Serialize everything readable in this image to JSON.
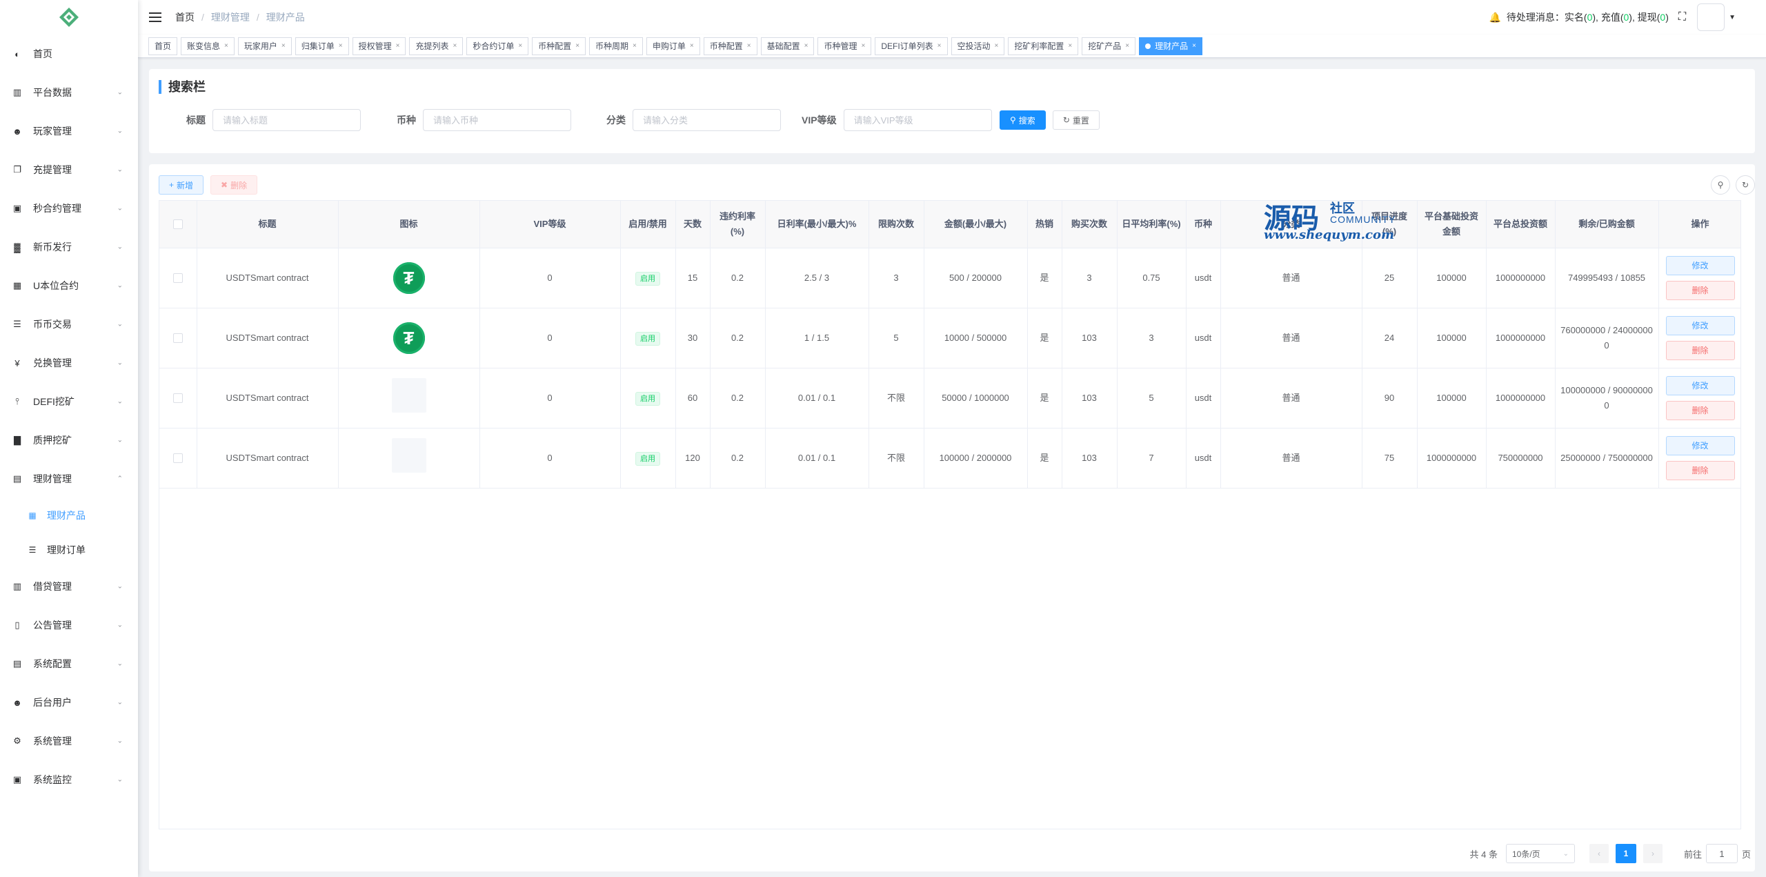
{
  "sidebar": {
    "logo_icon": "diamond-logo-icon",
    "items": [
      {
        "label": "首页",
        "icon": "dashboard-icon",
        "glyph": "◐",
        "has_arrow": false
      },
      {
        "label": "平台数据",
        "icon": "chart-book-icon",
        "glyph": "▥",
        "has_arrow": true
      },
      {
        "label": "玩家管理",
        "icon": "user-icon",
        "glyph": "☻",
        "has_arrow": true
      },
      {
        "label": "充提管理",
        "icon": "copy-icon",
        "glyph": "❐",
        "has_arrow": true
      },
      {
        "label": "秒合约管理",
        "icon": "monitor-icon",
        "glyph": "▣",
        "has_arrow": true
      },
      {
        "label": "新币发行",
        "icon": "chart-icon",
        "glyph": "▓",
        "has_arrow": true
      },
      {
        "label": "U本位合约",
        "icon": "grid-icon",
        "glyph": "▦",
        "has_arrow": true
      },
      {
        "label": "币币交易",
        "icon": "list-icon",
        "glyph": "☰",
        "has_arrow": true
      },
      {
        "label": "兑换管理",
        "icon": "yen-icon",
        "glyph": "¥",
        "has_arrow": true
      },
      {
        "label": "DEFI挖矿",
        "icon": "tree-icon",
        "glyph": "⫯",
        "has_arrow": true
      },
      {
        "label": "质押挖矿",
        "icon": "bar-chart-icon",
        "glyph": "▇",
        "has_arrow": true
      },
      {
        "label": "理财管理",
        "icon": "document-icon",
        "glyph": "▤",
        "has_arrow": true,
        "expanded": true
      }
    ],
    "sub_items": [
      {
        "label": "理财产品",
        "icon": "table-icon",
        "glyph": "▦",
        "active": true
      },
      {
        "label": "理财订单",
        "icon": "list-icon",
        "glyph": "☰",
        "active": false
      }
    ],
    "items_after": [
      {
        "label": "借贷管理",
        "icon": "book-icon",
        "glyph": "▥",
        "has_arrow": true
      },
      {
        "label": "公告管理",
        "icon": "open-book-icon",
        "glyph": "▯",
        "has_arrow": true
      },
      {
        "label": "系统配置",
        "icon": "form-icon",
        "glyph": "▤",
        "has_arrow": true
      },
      {
        "label": "后台用户",
        "icon": "users-icon",
        "glyph": "☻",
        "has_arrow": true
      },
      {
        "label": "系统管理",
        "icon": "gear-icon",
        "glyph": "⚙",
        "has_arrow": true
      },
      {
        "label": "系统监控",
        "icon": "monitor-icon",
        "glyph": "▣",
        "has_arrow": true
      }
    ]
  },
  "header": {
    "breadcrumb": [
      "首页",
      "理财管理",
      "理财产品"
    ],
    "notice_prefix": "待处理消息：",
    "notice_items": [
      {
        "label": "实名",
        "count": "0"
      },
      {
        "label": "充值",
        "count": "0"
      },
      {
        "label": "提现",
        "count": "0"
      }
    ]
  },
  "tags": [
    {
      "label": "首页",
      "closable": false,
      "active": false
    },
    {
      "label": "账变信息",
      "closable": true,
      "active": false
    },
    {
      "label": "玩家用户",
      "closable": true,
      "active": false
    },
    {
      "label": "归集订单",
      "closable": true,
      "active": false
    },
    {
      "label": "授权管理",
      "closable": true,
      "active": false
    },
    {
      "label": "充提列表",
      "closable": true,
      "active": false
    },
    {
      "label": "秒合约订单",
      "closable": true,
      "active": false
    },
    {
      "label": "币种配置",
      "closable": true,
      "active": false
    },
    {
      "label": "币种周期",
      "closable": true,
      "active": false
    },
    {
      "label": "申购订单",
      "closable": true,
      "active": false
    },
    {
      "label": "币种配置",
      "closable": true,
      "active": false
    },
    {
      "label": "基础配置",
      "closable": true,
      "active": false
    },
    {
      "label": "币种管理",
      "closable": true,
      "active": false
    },
    {
      "label": "DEFI订单列表",
      "closable": true,
      "active": false
    },
    {
      "label": "空投活动",
      "closable": true,
      "active": false
    },
    {
      "label": "挖矿利率配置",
      "closable": true,
      "active": false
    },
    {
      "label": "挖矿产品",
      "closable": true,
      "active": false
    },
    {
      "label": "理财产品",
      "closable": true,
      "active": true
    }
  ],
  "search": {
    "title": "搜索栏",
    "fields": [
      {
        "label": "标题",
        "placeholder": "请输入标题",
        "value": ""
      },
      {
        "label": "币种",
        "placeholder": "请输入币种",
        "value": ""
      },
      {
        "label": "分类",
        "placeholder": "请输入分类",
        "value": ""
      },
      {
        "label": "VIP等级",
        "placeholder": "请输入VIP等级",
        "value": ""
      }
    ],
    "search_button": "搜索",
    "reset_button": "重置"
  },
  "toolbar": {
    "add_label": "新增",
    "delete_label": "删除"
  },
  "table": {
    "columns": [
      "标题",
      "图标",
      "VIP等级",
      "启用/禁用",
      "天数",
      "违约利率(%)",
      "日利率(最小/最大)%",
      "限购次数",
      "金额(最小/最大)",
      "热销",
      "购买次数",
      "日平均利率(%)",
      "币种",
      "分类",
      "项目进度(%)",
      "平台基础投资金额",
      "平台总投资额",
      "剩余/已购金额",
      "操作"
    ],
    "rows": [
      {
        "title": "USDTSmart contract",
        "icon": "tether-coin",
        "vip": "0",
        "status": "启用",
        "days": "15",
        "penalty": "0.2",
        "daily_rate": "2.5 / 3",
        "limit": "3",
        "amount": "500 / 200000",
        "hot": "是",
        "buy_count": "3",
        "avg_rate": "0.75",
        "coin": "usdt",
        "category": "普通",
        "progress": "25",
        "base_invest": "100000",
        "total_invest": "1000000000",
        "remain": "749995493 / 10855"
      },
      {
        "title": "USDTSmart contract",
        "icon": "tether-coin",
        "vip": "0",
        "status": "启用",
        "days": "30",
        "penalty": "0.2",
        "daily_rate": "1 / 1.5",
        "limit": "5",
        "amount": "10000 / 500000",
        "hot": "是",
        "buy_count": "103",
        "avg_rate": "3",
        "coin": "usdt",
        "category": "普通",
        "progress": "24",
        "base_invest": "100000",
        "total_invest": "1000000000",
        "remain": "760000000 / 240000000"
      },
      {
        "title": "USDTSmart contract",
        "icon": "empty",
        "vip": "0",
        "status": "启用",
        "days": "60",
        "penalty": "0.2",
        "daily_rate": "0.01 / 0.1",
        "limit": "不限",
        "amount": "50000 / 1000000",
        "hot": "是",
        "buy_count": "103",
        "avg_rate": "5",
        "coin": "usdt",
        "category": "普通",
        "progress": "90",
        "base_invest": "100000",
        "total_invest": "1000000000",
        "remain": "100000000 / 900000000"
      },
      {
        "title": "USDTSmart contract",
        "icon": "empty",
        "vip": "0",
        "status": "启用",
        "days": "120",
        "penalty": "0.2",
        "daily_rate": "0.01 / 0.1",
        "limit": "不限",
        "amount": "100000 / 2000000",
        "hot": "是",
        "buy_count": "103",
        "avg_rate": "7",
        "coin": "usdt",
        "category": "普通",
        "progress": "75",
        "base_invest": "1000000000",
        "total_invest": "750000000",
        "remain": "25000000 / 750000000"
      }
    ],
    "edit_label": "修改",
    "remove_label": "删除"
  },
  "watermark": {
    "big": "源码",
    "small": "社区",
    "community": "COMMUNITY",
    "url": "www.shequym.com"
  },
  "pagination": {
    "total": "共 4 条",
    "page_size": "10条/页",
    "current": "1",
    "goto_label": "前往",
    "goto_value": "1",
    "page_suffix": "页"
  },
  "colors": {
    "primary": "#1890ff",
    "success": "#13ce66",
    "danger": "#f56c6c",
    "tether": "#0f9d58"
  }
}
